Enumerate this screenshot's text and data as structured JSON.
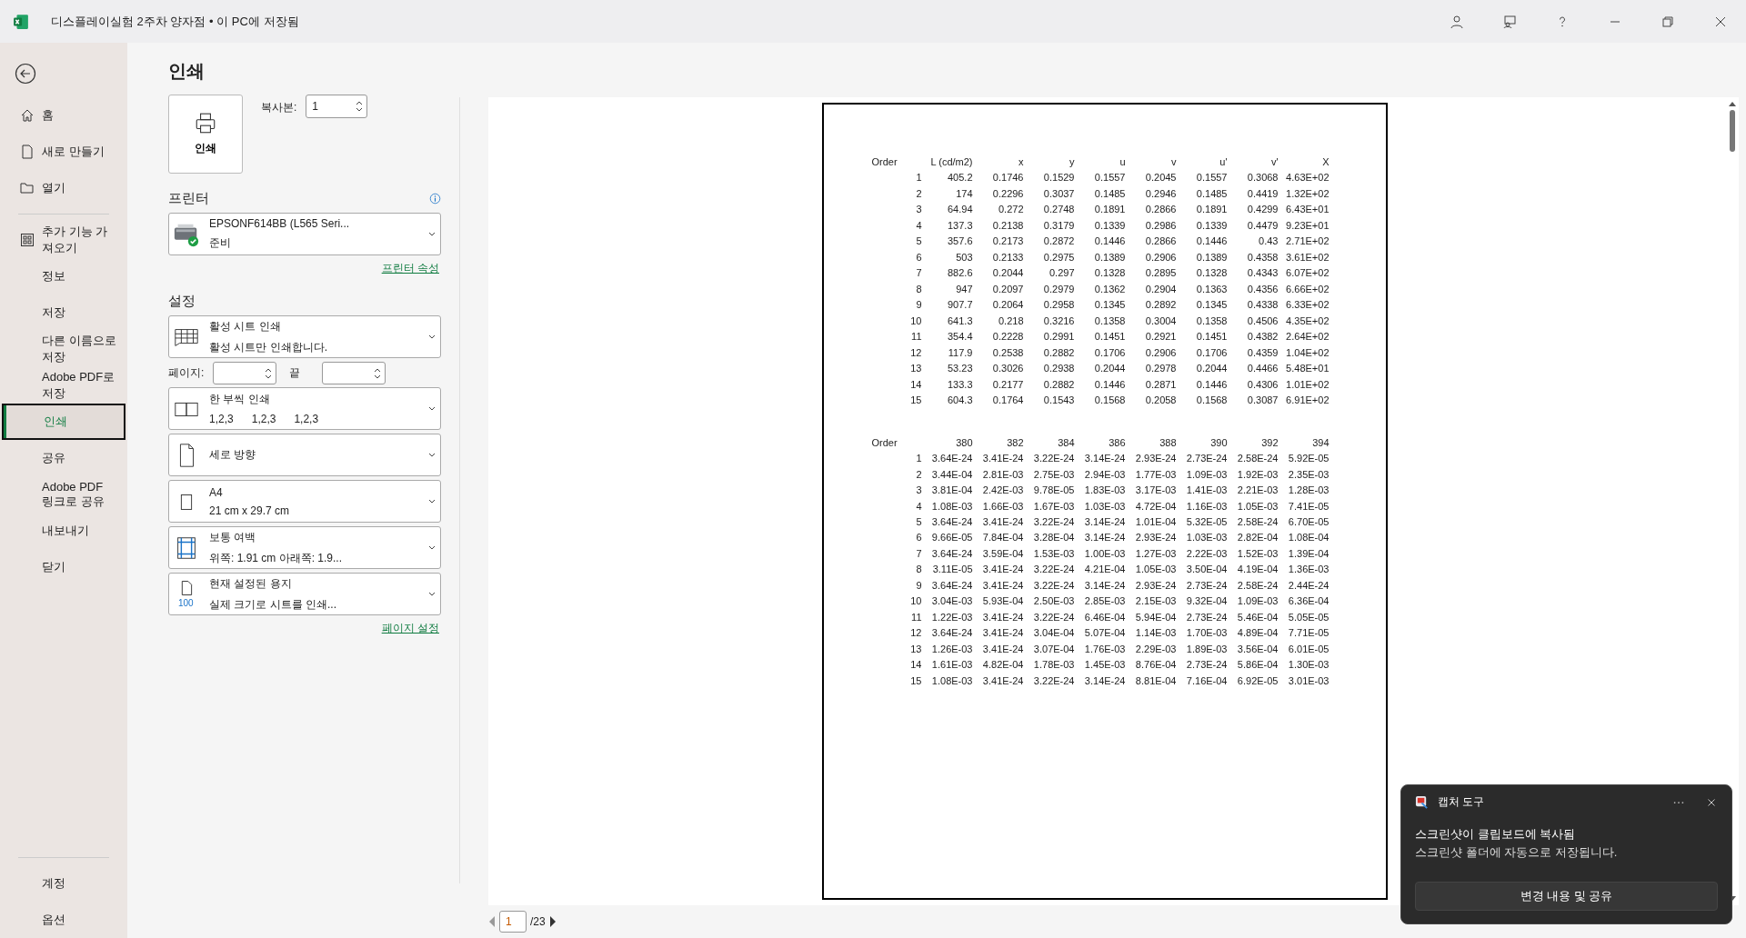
{
  "window": {
    "title": "디스플레이실험 2주차 양자점 • 이 PC에 저장됨"
  },
  "nav": {
    "top": [
      {
        "label": "홈",
        "selected": false
      },
      {
        "label": "새로 만들기",
        "selected": false
      },
      {
        "label": "열기",
        "selected": false
      }
    ],
    "middle": [
      {
        "label": "추가 기능 가져오기",
        "selected": false,
        "kind": "icon"
      },
      {
        "label": "정보",
        "selected": false,
        "kind": "text"
      },
      {
        "label": "저장",
        "selected": false,
        "kind": "text"
      },
      {
        "label": "다른 이름으로 저장",
        "selected": false,
        "kind": "text"
      },
      {
        "label": "Adobe PDF로 저장",
        "selected": false,
        "kind": "text"
      },
      {
        "label": "인쇄",
        "selected": true,
        "kind": "text"
      },
      {
        "label": "공유",
        "selected": false,
        "kind": "text"
      },
      {
        "label": "Adobe PDF 링크로 공유",
        "selected": false,
        "kind": "text"
      },
      {
        "label": "내보내기",
        "selected": false,
        "kind": "text"
      },
      {
        "label": "닫기",
        "selected": false,
        "kind": "text"
      }
    ],
    "bottom": [
      {
        "label": "계정",
        "selected": false
      },
      {
        "label": "옵션",
        "selected": false
      }
    ]
  },
  "print": {
    "heading": "인쇄",
    "button": "인쇄",
    "copies_label": "복사본:",
    "copies": "1",
    "printer_heading": "프린터",
    "printer": {
      "name": "EPSONF614BB (L565 Seri...",
      "status": "준비"
    },
    "printer_link": "프린터 속성",
    "settings_heading": "설정",
    "pages_label": "페이지:",
    "pages_to_label": "끝",
    "settings": [
      {
        "kind": "sheet",
        "title": "활성 시트 인쇄",
        "subtitle": "활성 시트만 인쇄합니다."
      },
      {
        "kind": "collate",
        "title": "한 부씩 인쇄",
        "subtitle_parts": [
          "1,2,3",
          "1,2,3",
          "1,2,3"
        ]
      },
      {
        "kind": "orientation",
        "title": "세로 방향"
      },
      {
        "kind": "paper",
        "title": "A4",
        "subtitle": "21 cm x 29.7 cm"
      },
      {
        "kind": "margins",
        "title": "보통 여백",
        "subtitle": "위쪽: 1.91 cm 아래쪽: 1.9..."
      },
      {
        "kind": "scaling",
        "title": "현재 설정된 용지",
        "subtitle": "실제 크기로 시트를 인쇄...",
        "icon_text": "100"
      }
    ],
    "page_setup_link": "페이지 설정"
  },
  "preview": {
    "tables": [
      {
        "columns": [
          "Order",
          "L (cd/m2)",
          "x",
          "y",
          "u",
          "v",
          "u'",
          "v'",
          "X"
        ],
        "rows": [
          [
            "1",
            "405.2",
            "0.1746",
            "0.1529",
            "0.1557",
            "0.2045",
            "0.1557",
            "0.3068",
            "4.63E+02"
          ],
          [
            "2",
            "174",
            "0.2296",
            "0.3037",
            "0.1485",
            "0.2946",
            "0.1485",
            "0.4419",
            "1.32E+02"
          ],
          [
            "3",
            "64.94",
            "0.272",
            "0.2748",
            "0.1891",
            "0.2866",
            "0.1891",
            "0.4299",
            "6.43E+01"
          ],
          [
            "4",
            "137.3",
            "0.2138",
            "0.3179",
            "0.1339",
            "0.2986",
            "0.1339",
            "0.4479",
            "9.23E+01"
          ],
          [
            "5",
            "357.6",
            "0.2173",
            "0.2872",
            "0.1446",
            "0.2866",
            "0.1446",
            "0.43",
            "2.71E+02"
          ],
          [
            "6",
            "503",
            "0.2133",
            "0.2975",
            "0.1389",
            "0.2906",
            "0.1389",
            "0.4358",
            "3.61E+02"
          ],
          [
            "7",
            "882.6",
            "0.2044",
            "0.297",
            "0.1328",
            "0.2895",
            "0.1328",
            "0.4343",
            "6.07E+02"
          ],
          [
            "8",
            "947",
            "0.2097",
            "0.2979",
            "0.1362",
            "0.2904",
            "0.1363",
            "0.4356",
            "6.66E+02"
          ],
          [
            "9",
            "907.7",
            "0.2064",
            "0.2958",
            "0.1345",
            "0.2892",
            "0.1345",
            "0.4338",
            "6.33E+02"
          ],
          [
            "10",
            "641.3",
            "0.218",
            "0.3216",
            "0.1358",
            "0.3004",
            "0.1358",
            "0.4506",
            "4.35E+02"
          ],
          [
            "11",
            "354.4",
            "0.2228",
            "0.2991",
            "0.1451",
            "0.2921",
            "0.1451",
            "0.4382",
            "2.64E+02"
          ],
          [
            "12",
            "117.9",
            "0.2538",
            "0.2882",
            "0.1706",
            "0.2906",
            "0.1706",
            "0.4359",
            "1.04E+02"
          ],
          [
            "13",
            "53.23",
            "0.3026",
            "0.2938",
            "0.2044",
            "0.2978",
            "0.2044",
            "0.4466",
            "5.48E+01"
          ],
          [
            "14",
            "133.3",
            "0.2177",
            "0.2882",
            "0.1446",
            "0.2871",
            "0.1446",
            "0.4306",
            "1.01E+02"
          ],
          [
            "15",
            "604.3",
            "0.1764",
            "0.1543",
            "0.1568",
            "0.2058",
            "0.1568",
            "0.3087",
            "6.91E+02"
          ]
        ]
      },
      {
        "columns": [
          "Order",
          "380",
          "382",
          "384",
          "386",
          "388",
          "390",
          "392",
          "394"
        ],
        "rows": [
          [
            "1",
            "3.64E-24",
            "3.41E-24",
            "3.22E-24",
            "3.14E-24",
            "2.93E-24",
            "2.73E-24",
            "2.58E-24",
            "5.92E-05"
          ],
          [
            "2",
            "3.44E-04",
            "2.81E-03",
            "2.75E-03",
            "2.94E-03",
            "1.77E-03",
            "1.09E-03",
            "1.92E-03",
            "2.35E-03"
          ],
          [
            "3",
            "3.81E-04",
            "2.42E-03",
            "9.78E-05",
            "1.83E-03",
            "3.17E-03",
            "1.41E-03",
            "2.21E-03",
            "1.28E-03"
          ],
          [
            "4",
            "1.08E-03",
            "1.66E-03",
            "1.67E-03",
            "1.03E-03",
            "4.72E-04",
            "1.16E-03",
            "1.05E-03",
            "7.41E-05"
          ],
          [
            "5",
            "3.64E-24",
            "3.41E-24",
            "3.22E-24",
            "3.14E-24",
            "1.01E-04",
            "5.32E-05",
            "2.58E-24",
            "6.70E-05"
          ],
          [
            "6",
            "9.66E-05",
            "7.84E-04",
            "3.28E-04",
            "3.14E-24",
            "2.93E-24",
            "1.03E-03",
            "2.82E-04",
            "1.08E-04"
          ],
          [
            "7",
            "3.64E-24",
            "3.59E-04",
            "1.53E-03",
            "1.00E-03",
            "1.27E-03",
            "2.22E-03",
            "1.52E-03",
            "1.39E-04"
          ],
          [
            "8",
            "3.11E-05",
            "3.41E-24",
            "3.22E-24",
            "4.21E-04",
            "1.05E-03",
            "3.50E-04",
            "4.19E-04",
            "1.36E-03"
          ],
          [
            "9",
            "3.64E-24",
            "3.41E-24",
            "3.22E-24",
            "3.14E-24",
            "2.93E-24",
            "2.73E-24",
            "2.58E-24",
            "2.44E-24"
          ],
          [
            "10",
            "3.04E-03",
            "5.93E-04",
            "2.50E-03",
            "2.85E-03",
            "2.15E-03",
            "9.32E-04",
            "1.09E-03",
            "6.36E-04"
          ],
          [
            "11",
            "1.22E-03",
            "3.41E-24",
            "3.22E-24",
            "6.46E-04",
            "5.94E-04",
            "2.73E-24",
            "5.46E-04",
            "5.05E-05"
          ],
          [
            "12",
            "3.64E-24",
            "3.41E-24",
            "3.04E-04",
            "5.07E-04",
            "1.14E-03",
            "1.70E-03",
            "4.89E-04",
            "7.71E-05"
          ],
          [
            "13",
            "1.26E-03",
            "3.41E-24",
            "3.07E-04",
            "1.76E-03",
            "2.29E-03",
            "1.89E-03",
            "3.56E-04",
            "6.01E-05"
          ],
          [
            "14",
            "1.61E-03",
            "4.82E-04",
            "1.78E-03",
            "1.45E-03",
            "8.76E-04",
            "2.73E-24",
            "5.86E-04",
            "1.30E-03"
          ],
          [
            "15",
            "1.08E-03",
            "3.41E-24",
            "3.22E-24",
            "3.14E-24",
            "8.81E-04",
            "7.16E-04",
            "6.92E-05",
            "3.01E-03"
          ]
        ]
      }
    ],
    "page": "1",
    "page_total": "/23"
  },
  "toast": {
    "app": "캡처 도구",
    "title": "스크린샷이 클립보드에 복사됨",
    "body": "스크린샷 폴더에 자동으로 저장됩니다.",
    "button": "변경 내용 및 공유"
  }
}
